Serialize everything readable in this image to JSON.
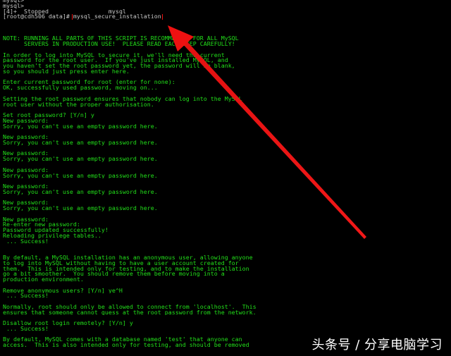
{
  "terminal": {
    "lines": [
      {
        "text": "mysql>",
        "color": "gray"
      },
      {
        "text": "mysql>",
        "color": "gray"
      },
      {
        "text": "[4]+  Stopped                 mysql",
        "color": "gray"
      },
      {
        "text": "[root@cdh506 data]# ",
        "color": "gray",
        "command": "mysql_secure_installation"
      },
      {
        "text": "",
        "color": "gray"
      },
      {
        "text": "",
        "color": "gray"
      },
      {
        "text": "",
        "color": "gray"
      },
      {
        "text": "NOTE: RUNNING ALL PARTS OF THIS SCRIPT IS RECOMMENDED FOR ALL MySQL",
        "color": "green"
      },
      {
        "text": "      SERVERS IN PRODUCTION USE!  PLEASE READ EACH STEP CAREFULLY!",
        "color": "green"
      },
      {
        "text": "",
        "color": "green"
      },
      {
        "text": "In order to log into MySQL to secure it, we'll need the current",
        "color": "green"
      },
      {
        "text": "password for the root user.  If you've just installed MySQL, and",
        "color": "green"
      },
      {
        "text": "you haven't set the root password yet, the password will be blank,",
        "color": "green"
      },
      {
        "text": "so you should just press enter here.",
        "color": "green"
      },
      {
        "text": "",
        "color": "green"
      },
      {
        "text": "Enter current password for root (enter for none):",
        "color": "green"
      },
      {
        "text": "OK, successfully used password, moving on...",
        "color": "green"
      },
      {
        "text": "",
        "color": "green"
      },
      {
        "text": "Setting the root password ensures that nobody can log into the MySQL",
        "color": "green"
      },
      {
        "text": "root user without the proper authorisation.",
        "color": "green"
      },
      {
        "text": "",
        "color": "green"
      },
      {
        "text": "Set root password? [Y/n] y",
        "color": "green"
      },
      {
        "text": "New password:",
        "color": "green"
      },
      {
        "text": "Sorry, you can't use an empty password here.",
        "color": "green"
      },
      {
        "text": "",
        "color": "green"
      },
      {
        "text": "New password:",
        "color": "green"
      },
      {
        "text": "Sorry, you can't use an empty password here.",
        "color": "green"
      },
      {
        "text": "",
        "color": "green"
      },
      {
        "text": "New password:",
        "color": "green"
      },
      {
        "text": "Sorry, you can't use an empty password here.",
        "color": "green"
      },
      {
        "text": "",
        "color": "green"
      },
      {
        "text": "New password:",
        "color": "green"
      },
      {
        "text": "Sorry, you can't use an empty password here.",
        "color": "green"
      },
      {
        "text": "",
        "color": "green"
      },
      {
        "text": "New password:",
        "color": "green"
      },
      {
        "text": "Sorry, you can't use an empty password here.",
        "color": "green"
      },
      {
        "text": "",
        "color": "green"
      },
      {
        "text": "New password:",
        "color": "green"
      },
      {
        "text": "Sorry, you can't use an empty password here.",
        "color": "green"
      },
      {
        "text": "",
        "color": "green"
      },
      {
        "text": "New password:",
        "color": "green"
      },
      {
        "text": "Re-enter new password:",
        "color": "green"
      },
      {
        "text": "Password updated successfully!",
        "color": "green"
      },
      {
        "text": "Reloading privilege tables..",
        "color": "green"
      },
      {
        "text": " ... Success!",
        "color": "green"
      },
      {
        "text": "",
        "color": "green"
      },
      {
        "text": "",
        "color": "green"
      },
      {
        "text": "By default, a MySQL installation has an anonymous user, allowing anyone",
        "color": "green"
      },
      {
        "text": "to log into MySQL without having to have a user account created for",
        "color": "green"
      },
      {
        "text": "them.  This is intended only for testing, and to make the installation",
        "color": "green"
      },
      {
        "text": "go a bit smoother.  You should remove them before moving into a",
        "color": "green"
      },
      {
        "text": "production environment.",
        "color": "green"
      },
      {
        "text": "",
        "color": "green"
      },
      {
        "text": "Remove anonymous users? [Y/n] ye^H",
        "color": "green"
      },
      {
        "text": " ... Success!",
        "color": "green"
      },
      {
        "text": "",
        "color": "green"
      },
      {
        "text": "Normally, root should only be allowed to connect from 'localhost'.  This",
        "color": "green"
      },
      {
        "text": "ensures that someone cannot guess at the root password from the network.",
        "color": "green"
      },
      {
        "text": "",
        "color": "green"
      },
      {
        "text": "Disallow root login remotely? [Y/n] y",
        "color": "green"
      },
      {
        "text": " ... Success!",
        "color": "green"
      },
      {
        "text": "",
        "color": "green"
      },
      {
        "text": "By default, MySQL comes with a database named 'test' that anyone can",
        "color": "green"
      },
      {
        "text": "access.  This is also intended only for testing, and should be removed",
        "color": "green"
      }
    ]
  },
  "watermark": "头条号 / 分享电脑学习",
  "colors": {
    "terminal_bg": "#000000",
    "prompt_text": "#c8c8c8",
    "output_text": "#22e01a",
    "highlight": "#ee1111"
  }
}
